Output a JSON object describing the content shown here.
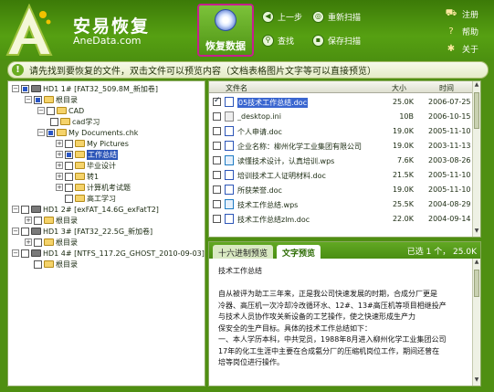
{
  "brand": {
    "title": "安易恢复",
    "url": "AneData.com"
  },
  "toolbar": {
    "main_label": "恢复数据",
    "prev": "上一步",
    "rescan": "重新扫描",
    "find": "查找",
    "save_scan": "保存扫描"
  },
  "right_menu": {
    "register": "注册",
    "help": "帮助",
    "about": "关于"
  },
  "hint": "请先找到要恢复的文件，双击文件可以预览内容（文档表格图片文字等可以直接预览）",
  "tree": [
    {
      "label": "HD1 1# [FAT32_509.8M_新加卷]",
      "type": "disk"
    },
    {
      "label": "根目录",
      "type": "folder"
    },
    {
      "label": "CAD",
      "type": "folder"
    },
    {
      "label": "cad学习",
      "type": "folder"
    },
    {
      "label": "My Documents.chk",
      "type": "folder"
    },
    {
      "label": "My Pictures",
      "type": "folder"
    },
    {
      "label": "工作总结",
      "type": "folder",
      "selected": true
    },
    {
      "label": "毕业设计",
      "type": "folder"
    },
    {
      "label": "转1",
      "type": "folder"
    },
    {
      "label": "计算机考试题",
      "type": "folder"
    },
    {
      "label": "高工学习",
      "type": "folder"
    },
    {
      "label": "HD1 2# [exFAT_14.6G_exFatT2]",
      "type": "disk"
    },
    {
      "label": "根目录",
      "type": "folder"
    },
    {
      "label": "HD1 3# [FAT32_22.5G_新加卷]",
      "type": "disk"
    },
    {
      "label": "根目录",
      "type": "folder"
    },
    {
      "label": "HD1 4# [NTFS_117.2G_GHOST_2010-09-03]",
      "type": "disk"
    },
    {
      "label": "根目录",
      "type": "folder"
    }
  ],
  "files": {
    "columns": [
      "文件名",
      "大小",
      "时间"
    ],
    "rows": [
      {
        "name": "05技术工作总结.doc",
        "size": "25.0K",
        "date": "2006-07-25",
        "icon": "doc",
        "checked": true,
        "selected": true
      },
      {
        "name": "_desktop.ini",
        "size": "10B",
        "date": "2006-10-15",
        "icon": "ini"
      },
      {
        "name": "个人申请.doc",
        "size": "19.0K",
        "date": "2005-11-10",
        "icon": "doc"
      },
      {
        "name": "企业名称：柳州化学工业集团有限公司",
        "size": "19.0K",
        "date": "2003-11-13",
        "icon": "doc"
      },
      {
        "name": "读懂技术设计，认真培训.wps",
        "size": "7.6K",
        "date": "2003-08-26",
        "icon": "wps"
      },
      {
        "name": "培训技术工人证明材料.doc",
        "size": "21.5K",
        "date": "2005-11-10",
        "icon": "doc"
      },
      {
        "name": "所获荣誉.doc",
        "size": "19.0K",
        "date": "2005-11-10",
        "icon": "doc"
      },
      {
        "name": "技术工作总结.wps",
        "size": "25.5K",
        "date": "2004-08-29",
        "icon": "wps"
      },
      {
        "name": "技术工作总结zlm.doc",
        "size": "22.0K",
        "date": "2004-09-14",
        "icon": "doc"
      }
    ]
  },
  "preview": {
    "tab_hex": "十六进制预览",
    "tab_text": "文字预览",
    "status": "已选 1 个， 25.0K",
    "lines": [
      "技术工作总结",
      "",
      "自从被评为助工三年来，正是我公司快速发展的时期，合成分厂更是",
      "冷器、高压机一次冷却冷改循环水、12#、13#高压机等项目相继投产",
      "与技术人员协作攻关新设备的工艺操作，使之快速形成生产力",
      "保安全的生产目标。具体的技术工作总结如下：",
      "一、本人学历本科，中共党员，1988年8月进入柳州化学工业集团公司",
      "17年的化工生涯中主要在合成氨分厂的压缩机岗位工作，期间还曾在",
      "培等岗位进行操作。"
    ]
  },
  "colors": {
    "brand_green": "#4f8f12",
    "main_button_border": "#c71f8e",
    "selection_blue": "#2b55b8"
  }
}
